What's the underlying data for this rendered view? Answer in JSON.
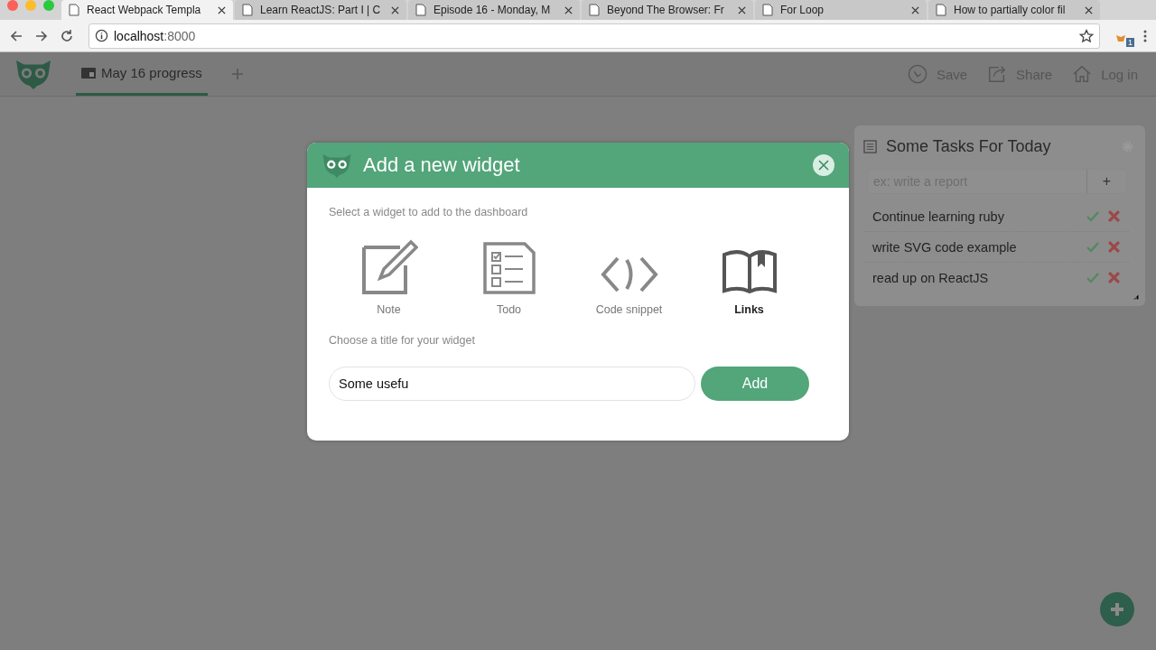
{
  "browser": {
    "tabs": [
      {
        "title": "React Webpack Templa",
        "selected": true
      },
      {
        "title": "Learn ReactJS: Part I | C",
        "selected": false
      },
      {
        "title": "Episode 16 - Monday, M",
        "selected": false
      },
      {
        "title": "Beyond The Browser: Fr",
        "selected": false
      },
      {
        "title": "For Loop",
        "selected": false
      },
      {
        "title": "How to partially color fil",
        "selected": false
      }
    ],
    "address": {
      "host": "localhost",
      "port": ":8000"
    },
    "extension_badge": "1"
  },
  "app": {
    "tabs": [
      {
        "label": "May 16 progress",
        "selected": true
      }
    ],
    "actions": [
      {
        "kind": "save",
        "label": "Save"
      },
      {
        "kind": "share",
        "label": "Share"
      },
      {
        "kind": "login",
        "label": "Log in"
      }
    ]
  },
  "task_widget": {
    "title": "Some Tasks For Today",
    "input_placeholder": "ex: write a report",
    "add_label": "+",
    "tasks": [
      {
        "text": "Continue learning ruby"
      },
      {
        "text": "write SVG code example"
      },
      {
        "text": "read up on ReactJS"
      }
    ]
  },
  "dialog": {
    "title": "Add a new widget",
    "select_prompt": "Select a widget to add to the dashboard",
    "widgets": [
      {
        "kind": "note",
        "label": "Note",
        "selected": false
      },
      {
        "kind": "todo",
        "label": "Todo",
        "selected": false
      },
      {
        "kind": "code",
        "label": "Code snippet",
        "selected": false
      },
      {
        "kind": "links",
        "label": "Links",
        "selected": true
      }
    ],
    "title_prompt": "Choose a title for your widget",
    "title_value": "Some usefu",
    "add_button": "Add"
  }
}
